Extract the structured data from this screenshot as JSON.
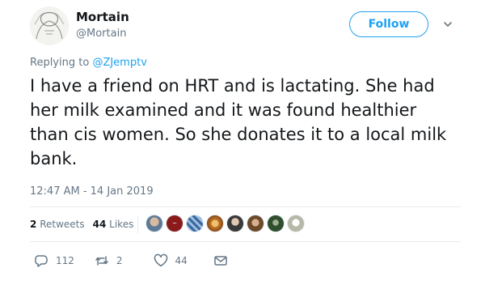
{
  "tweet": {
    "display_name": "Mortain",
    "handle": "@Mortain",
    "follow_label": "Follow",
    "replying_prefix": "Replying to ",
    "replying_handle": "@ZJemptv",
    "text": "I have a friend on HRT and is lactating. She had her milk examined and it was found healthier than cis women. So she donates it to a local milk bank.",
    "timestamp": "12:47 AM - 14 Jan 2019"
  },
  "stats": {
    "retweets_count": "2",
    "retweets_label": "Retweets",
    "likes_count": "44",
    "likes_label": "Likes"
  },
  "likers": [
    {
      "icon": "avatar-man"
    },
    {
      "icon": "avatar-meme-text",
      "color": "#8b1a1a"
    },
    {
      "icon": "avatar-pattern",
      "color": "#3b6aa0"
    },
    {
      "icon": "avatar-gears",
      "color": "#c77a2a"
    },
    {
      "icon": "avatar-person"
    },
    {
      "icon": "avatar-hair",
      "color": "#6b4a2a"
    },
    {
      "icon": "avatar-dark",
      "color": "#2f4f2f"
    },
    {
      "icon": "avatar-sketch"
    }
  ],
  "actions": {
    "reply_count": "112",
    "retweet_count": "2",
    "like_count": "44"
  },
  "colors": {
    "accent": "#1da1f2",
    "muted": "#657786",
    "text": "#14171a"
  }
}
